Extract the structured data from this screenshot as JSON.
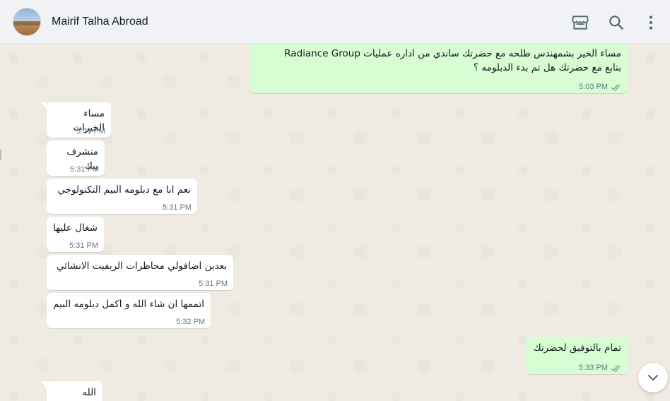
{
  "header": {
    "contact_name": "Mairif Talha Abroad",
    "icons": [
      "shop-icon",
      "search-icon",
      "menu-dots-icon"
    ]
  },
  "messages": [
    {
      "dir": "out",
      "lines": [
        "مساء الخير بشمهندس طلحه مع حضرتك ساندي من اداره عمليات Radiance Group",
        "بتابع مع حضرتك هل تم بدء الدبلومه ؟"
      ],
      "time": "5:03 PM",
      "status": "read"
    },
    {
      "dir": "in",
      "text": "مساء الخيرات",
      "time": "5:31 PM"
    },
    {
      "dir": "in",
      "text": "متشرف بيك",
      "time": "5:31 PM"
    },
    {
      "dir": "in",
      "text": "نعم انا مع دبلومه البيم التكنولوجي",
      "time": "5:31 PM"
    },
    {
      "dir": "in",
      "text": "شغال عليها",
      "time": "5:31 PM"
    },
    {
      "dir": "in",
      "text": "بعدين اضافولي محاظرات الريفيت الانشائي",
      "time": "5:31 PM"
    },
    {
      "dir": "in",
      "text": "اتممها ان شاء الله و اكمل دبلومه البيم",
      "time": "5:32 PM"
    },
    {
      "dir": "out",
      "text": "تمام بالتوفيق لحضرتك",
      "time": "5:33 PM",
      "status": "read"
    },
    {
      "dir": "in",
      "text": "الله يسلمك",
      "time": ""
    }
  ],
  "colors": {
    "header_bg": "#f0f2f5",
    "chat_bg": "#efeae2",
    "incoming_bubble": "#ffffff",
    "outgoing_bubble": "#d9fdd3",
    "read_ticks": "#8696a0"
  }
}
